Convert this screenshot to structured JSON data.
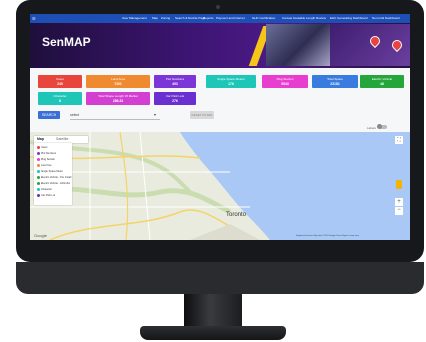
{
  "navbar": {
    "items": [
      "User Management",
      "Map",
      "Zoning",
      "Search & Decide Page",
      "Reports",
      "Payment and Internet",
      "GHC Certification",
      "Canvas bookable Length Review",
      "EHC Generating Dashboard",
      "Non-Grid Dashboard"
    ]
  },
  "banner": {
    "title": "SenMAP"
  },
  "cards": [
    {
      "label": "Users",
      "value": "245",
      "color": "#e8453c"
    },
    {
      "label": "Land Area",
      "value": "7301",
      "color": "#f08a30"
    },
    {
      "label": "Plot Numbers",
      "value": "493",
      "color": "#7c35d6"
    },
    {
      "label": "Single Space Meters",
      "value": "178",
      "color": "#1ec6b8"
    },
    {
      "label": "Plog Section",
      "value": "5543",
      "color": "#e83ecf"
    },
    {
      "label": "Total Space",
      "value": "22181",
      "color": "#3a7be0"
    },
    {
      "label": "Electric Vehicle",
      "value": "48",
      "color": "#24a63a"
    },
    {
      "label": "Character",
      "value": "8",
      "color": "#1ec6b8"
    },
    {
      "label": "Total Shape Length Of Market",
      "value": "286.33",
      "color": "#d33fd1"
    },
    {
      "label": "Car Park Lots",
      "value": "276",
      "color": "#6a2fd0"
    }
  ],
  "controls": {
    "search_label": "SEARCH",
    "select_value": "select",
    "reset_label": "RESET FILTER",
    "toggle_label": "Labels"
  },
  "map": {
    "tab_map": "Map",
    "tab_satellite": "Satellite",
    "legend": [
      {
        "label": "Users",
        "color": "#e8453c"
      },
      {
        "label": "Plot Numbers",
        "color": "#7c35d6"
      },
      {
        "label": "Plog Section",
        "color": "#e83ecf"
      },
      {
        "label": "Land Use",
        "color": "#f08a30"
      },
      {
        "label": "Single Space Meter",
        "color": "#1ec6b8"
      },
      {
        "label": "Electric Vehicle - Pre Install",
        "color": "#24a63a"
      },
      {
        "label": "Electric Vehicle - Arthrobix",
        "color": "#24a63a"
      },
      {
        "label": "Character",
        "color": "#1ec6b8"
      },
      {
        "label": "Car Park Lot",
        "color": "#6a2fd0"
      }
    ],
    "city_label": "Toronto",
    "google_logo": "Google",
    "attribution": "Keyboard shortcuts   Map data ©2023 Google   Terms   Report a map error"
  },
  "colors": {
    "navbar": "#1d4fb6",
    "banner": "#3b1470",
    "water": "#a9c8f5"
  }
}
